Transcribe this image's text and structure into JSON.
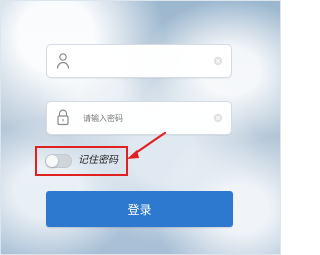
{
  "login_form": {
    "username": {
      "value": "",
      "placeholder": "",
      "icon": "user-icon",
      "clear_icon": "clear-icon"
    },
    "password": {
      "value": "",
      "placeholder": "请输入密码",
      "icon": "lock-icon",
      "clear_icon": "clear-icon"
    },
    "remember_password": {
      "label": "记住密码",
      "enabled": false,
      "highlight_color": "#e12020"
    },
    "login_button": {
      "label": "登录",
      "color": "#2d79cf"
    }
  },
  "annotation": {
    "arrow_icon": "arrow-icon",
    "color": "#e12020"
  }
}
